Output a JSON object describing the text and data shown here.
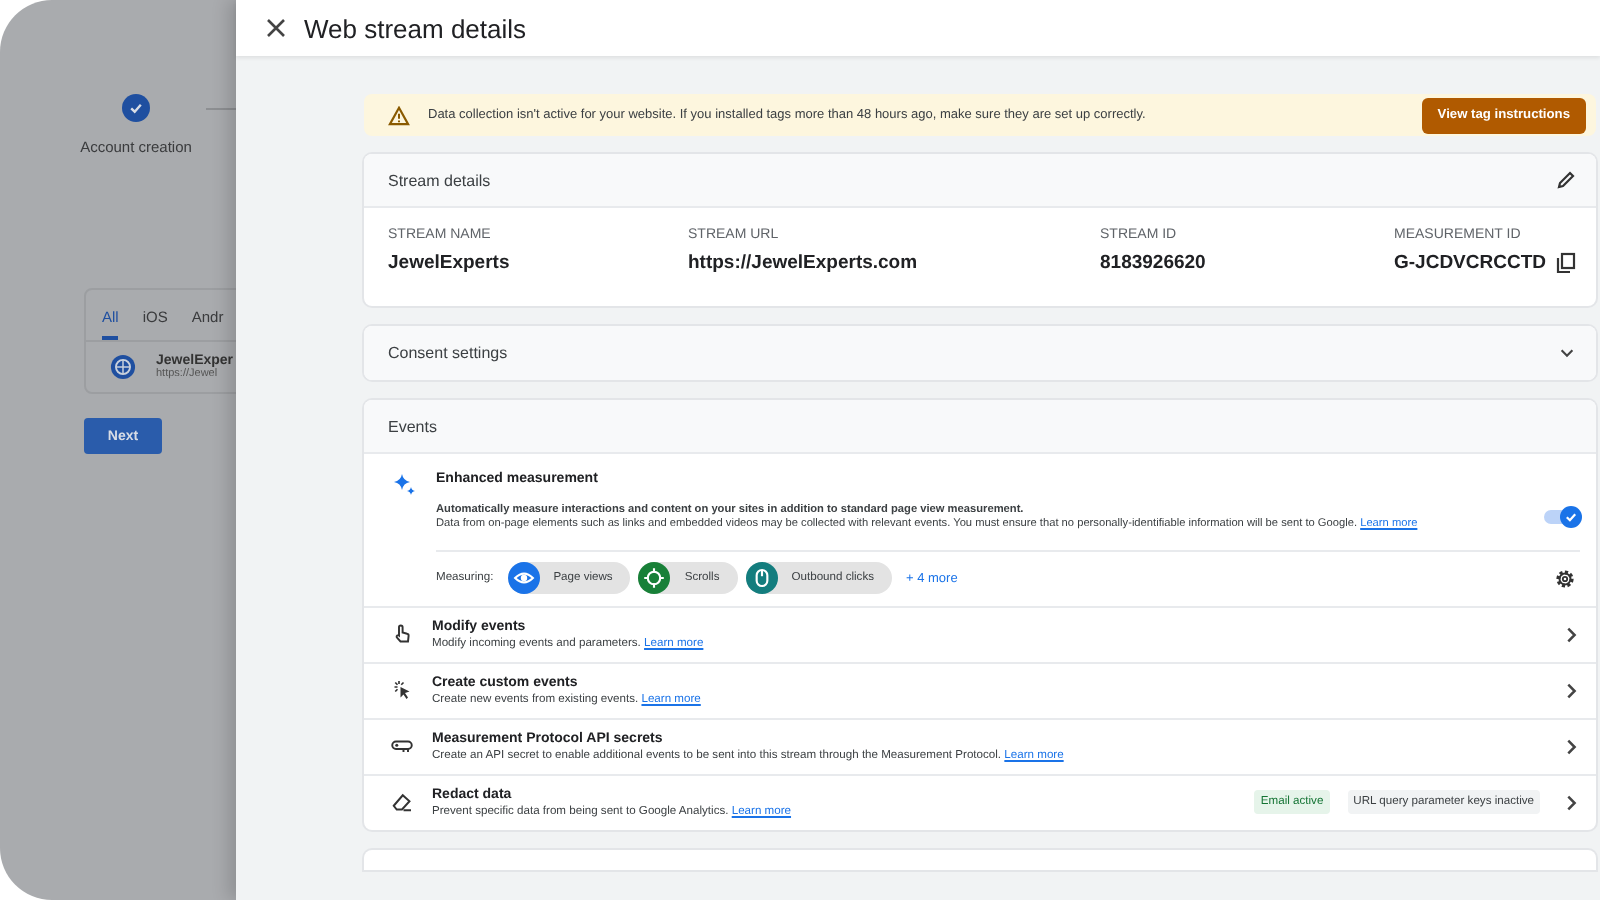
{
  "backdrop": {
    "steps": [
      {
        "label": "Account creation",
        "done": true
      }
    ],
    "tabs": [
      {
        "label": "All",
        "selected": true
      },
      {
        "label": "iOS",
        "selected": false
      },
      {
        "label": "Andr",
        "selected": false
      }
    ],
    "streams": [
      {
        "name": "JewelExper",
        "url": "https://Jewel"
      }
    ],
    "next_button": "Next"
  },
  "panel": {
    "title": "Web stream details"
  },
  "alert": {
    "message": "Data collection isn't active for your website. If you installed tags more than 48 hours ago, make sure they are set up correctly.",
    "button": "View tag instructions"
  },
  "stream_details": {
    "title": "Stream details",
    "fields": [
      {
        "label": "STREAM NAME",
        "value": "JewelExperts",
        "copyable": false
      },
      {
        "label": "STREAM URL",
        "value": "https://JewelExperts.com",
        "copyable": false
      },
      {
        "label": "STREAM ID",
        "value": "8183926620",
        "copyable": false
      },
      {
        "label": "MEASUREMENT ID",
        "value": "G-JCDVCRCCTD",
        "copyable": true
      }
    ]
  },
  "consent": {
    "title": "Consent settings",
    "expanded": false
  },
  "events": {
    "title": "Events",
    "enhanced": {
      "title": "Enhanced measurement",
      "summary": "Automatically measure interactions and content on your sites in addition to standard page view measurement.",
      "detail": "Data from on-page elements such as links and embedded videos may be collected with relevant events. You must ensure that no personally-identifiable information will be sent to Google.",
      "link": "Learn more",
      "on": true,
      "measuring_label": "Measuring:",
      "chips": [
        {
          "label": "Page views",
          "kind": "eye",
          "color": "#1a73e8"
        },
        {
          "label": "Scrolls",
          "kind": "crosshair",
          "color": "#188038"
        },
        {
          "label": "Outbound clicks",
          "kind": "mouse",
          "color": "#137d7e"
        }
      ],
      "more": "+ 4 more"
    },
    "items": [
      {
        "kind": "hand",
        "title": "Modify events",
        "description": "Modify incoming events and parameters.",
        "link": "Learn more"
      },
      {
        "kind": "sparkle",
        "title": "Create custom events",
        "description": "Create new events from existing events.",
        "link": "Learn more"
      },
      {
        "kind": "key",
        "title": "Measurement Protocol API secrets",
        "description": "Create an API secret to enable additional events to be sent into this stream through the Measurement Protocol.",
        "link": "Learn more"
      },
      {
        "kind": "eraser",
        "title": "Redact data",
        "description": "Prevent specific data from being sent to Google Analytics.",
        "link": "Learn more",
        "badges": [
          {
            "label": "Email active",
            "color": "#e6f4ea"
          },
          {
            "label": "URL query parameter keys inactive",
            "color": "#f1f3f4"
          }
        ]
      }
    ]
  }
}
